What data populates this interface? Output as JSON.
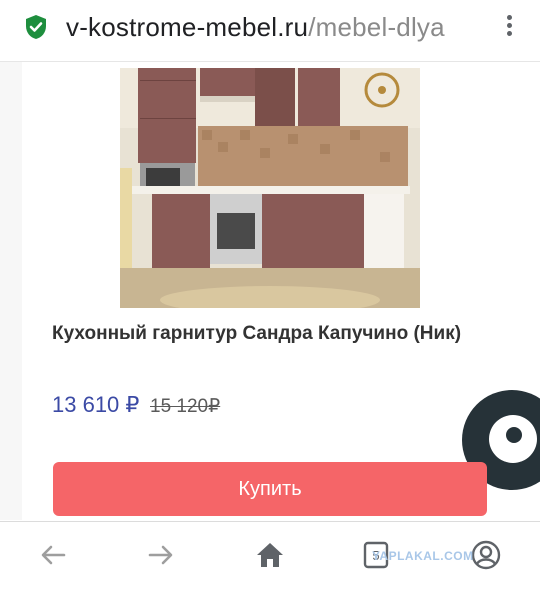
{
  "address_bar": {
    "domain": "v-kostrome-mebel.ru",
    "path": "/mebel-dlya"
  },
  "product": {
    "title": "Кухонный гарнитур Сандра Капучино (Ник)",
    "price": "13 610 ₽",
    "old_price": "15 120₽",
    "buy_label": "Купить"
  },
  "bottom_nav": {
    "tab_count": "5"
  },
  "watermark": "YAPLAKAL.COM",
  "colors": {
    "price": "#3b4aa5",
    "buy_button": "#f56568",
    "chat_bubble": "#263238",
    "lock": "#1e8e3e"
  },
  "icons": [
    "lock-icon",
    "menu-icon",
    "chat-icon",
    "back-icon",
    "forward-icon",
    "home-icon",
    "tabs-icon",
    "account-icon"
  ]
}
